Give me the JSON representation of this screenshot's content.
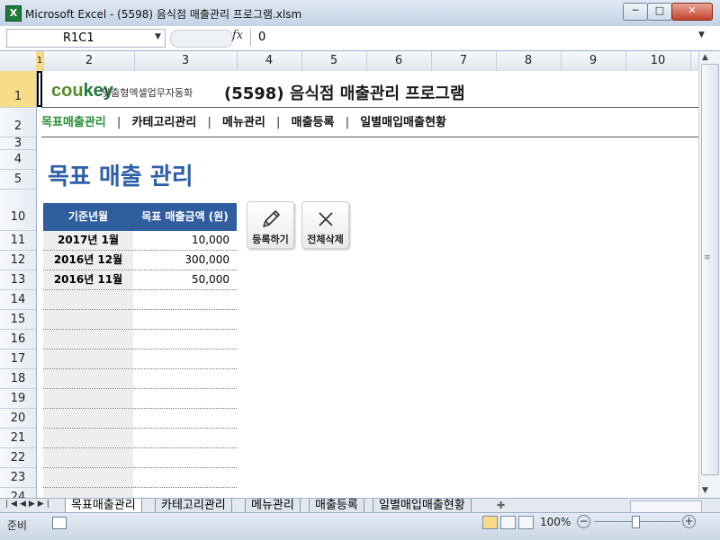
{
  "window": {
    "title": "Microsoft Excel - (5598) 음식점 매출관리 프로그램.xlsm",
    "app_icon": "X",
    "minimize": "─",
    "maximize": "□",
    "close": "✕"
  },
  "formula_bar": {
    "name_box": "R1C1",
    "fx": "fx",
    "value": "0"
  },
  "columns": [
    "1",
    "2",
    "3",
    "4",
    "5",
    "6",
    "7",
    "8",
    "9",
    "10"
  ],
  "rows": [
    "1",
    "2",
    "3",
    "4",
    "5",
    "10",
    "11",
    "12",
    "13",
    "14",
    "15",
    "16",
    "17",
    "18",
    "19",
    "20",
    "21",
    "22",
    "23",
    "24"
  ],
  "header": {
    "logo_part1": "cou",
    "logo_part2": "key",
    "tagline": "맞춤형엑셀업무자동화",
    "title": "(5598) 음식점 매출관리 프로그램"
  },
  "nav": {
    "items": [
      "목표매출관리",
      "카테고리관리",
      "메뉴관리",
      "매출등록",
      "일별매입매출현황"
    ],
    "separator": "|",
    "active_index": 0
  },
  "page_heading": "목표 매출 관리",
  "target_table": {
    "headers": [
      "기준년월",
      "목표 매출금액 (원)"
    ],
    "rows": [
      {
        "month": "2017년 1월",
        "amount": "10,000"
      },
      {
        "month": "2016년 12월",
        "amount": "300,000"
      },
      {
        "month": "2016년 11월",
        "amount": "50,000"
      },
      {
        "month": "",
        "amount": ""
      },
      {
        "month": "",
        "amount": ""
      },
      {
        "month": "",
        "amount": ""
      },
      {
        "month": "",
        "amount": ""
      },
      {
        "month": "",
        "amount": ""
      },
      {
        "month": "",
        "amount": ""
      },
      {
        "month": "",
        "amount": ""
      },
      {
        "month": "",
        "amount": ""
      },
      {
        "month": "",
        "amount": ""
      },
      {
        "month": "",
        "amount": ""
      },
      {
        "month": "",
        "amount": ""
      }
    ]
  },
  "buttons": {
    "register": {
      "label": "등록하기",
      "icon": "pencil-icon"
    },
    "delete_all": {
      "label": "전체삭제",
      "icon": "close-icon"
    }
  },
  "sheet_tabs": [
    "목표매출관리",
    "카테고리관리",
    "메뉴관리",
    "매출등록",
    "일별매입매출현황"
  ],
  "status_bar": {
    "ready": "준비",
    "zoom": "100%",
    "zoom_out": "−",
    "zoom_in": "+"
  },
  "colors": {
    "accent_blue": "#2f5d9e",
    "heading_blue": "#2e5fa8",
    "nav_active_green": "#2a8c35",
    "logo_green": "#1e7b3a"
  }
}
